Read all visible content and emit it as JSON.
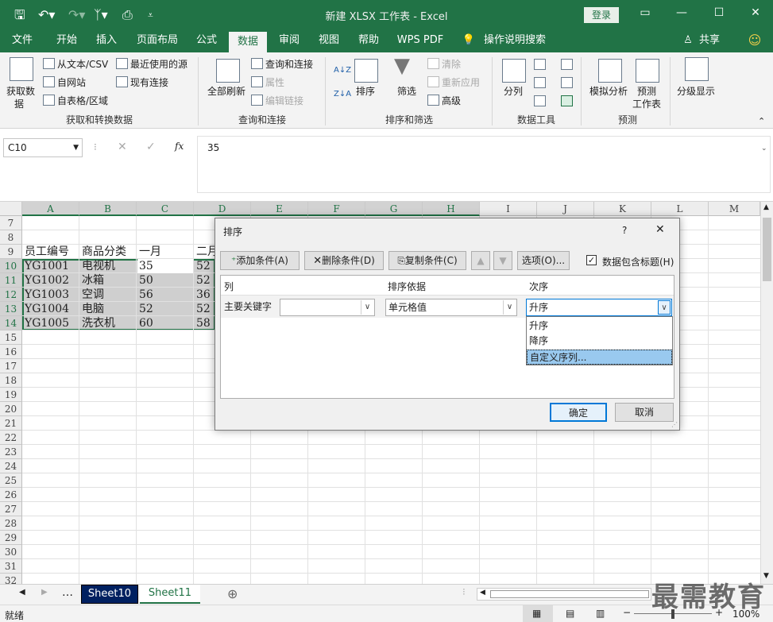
{
  "titlebar": {
    "title": "新建 XLSX 工作表 - Excel",
    "login": "登录"
  },
  "tabs": [
    "文件",
    "开始",
    "插入",
    "页面布局",
    "公式",
    "数据",
    "审阅",
    "视图",
    "帮助",
    "WPS PDF",
    "操作说明搜索"
  ],
  "share": "共享",
  "ribbon": {
    "get_data": "获取数",
    "get_data2": "据",
    "from_text": "从文本/CSV",
    "from_web": "自网站",
    "from_table": "自表格/区域",
    "recent_sources": "最近使用的源",
    "existing_conn": "现有连接",
    "group1": "获取和转换数据",
    "refresh_all": "全部刷新",
    "queries_conn": "查询和连接",
    "properties": "属性",
    "edit_links": "编辑链接",
    "group2": "查询和连接",
    "sort": "排序",
    "filter": "筛选",
    "clear": "清除",
    "reapply": "重新应用",
    "advanced": "高级",
    "group3": "排序和筛选",
    "text_to_columns": "分列",
    "group4": "数据工具",
    "what_if": "模拟分析",
    "forecast": "预测",
    "forecast2": "工作表",
    "group5": "预测",
    "outline": "分级显示"
  },
  "formula_bar": {
    "name_box": "C10",
    "content": "35",
    "fx": "fx"
  },
  "columns": [
    "A",
    "B",
    "C",
    "D",
    "E",
    "F",
    "G",
    "H",
    "I",
    "J",
    "K",
    "L",
    "M"
  ],
  "rows": [
    "7",
    "8",
    "9",
    "10",
    "11",
    "12",
    "13",
    "14",
    "15",
    "16",
    "17",
    "18",
    "19",
    "20",
    "21",
    "22",
    "23",
    "24",
    "25",
    "26",
    "27",
    "28",
    "29",
    "30",
    "31",
    "32"
  ],
  "cells": {
    "headers": [
      "员工编号",
      "商品分类",
      "一月",
      "二月"
    ],
    "data": [
      [
        "YG1001",
        "电视机",
        "35",
        "52"
      ],
      [
        "YG1002",
        "冰箱",
        "50",
        "52"
      ],
      [
        "YG1003",
        "空调",
        "56",
        "36"
      ],
      [
        "YG1004",
        "电脑",
        "52",
        "52"
      ],
      [
        "YG1005",
        "洗衣机",
        "60",
        "58"
      ]
    ]
  },
  "dialog": {
    "title": "排序",
    "help": "?",
    "close": "✕",
    "add_level": "添加条件(A)",
    "delete_level": "删除条件(D)",
    "copy_level": "复制条件(C)",
    "options": "选项(O)...",
    "has_headers": "数据包含标题(H)",
    "col_header": "列",
    "sort_on_header": "排序依据",
    "order_header": "次序",
    "primary_key": "主要关键字",
    "sort_on_value": "单元格值",
    "order_value": "升序",
    "order_options": [
      "升序",
      "降序",
      "自定义序列..."
    ],
    "ok": "确定",
    "cancel": "取消"
  },
  "sheets": [
    "Sheet10",
    "Sheet11"
  ],
  "status": {
    "ready": "就绪",
    "zoom": "100%"
  },
  "watermark": "最需教育"
}
